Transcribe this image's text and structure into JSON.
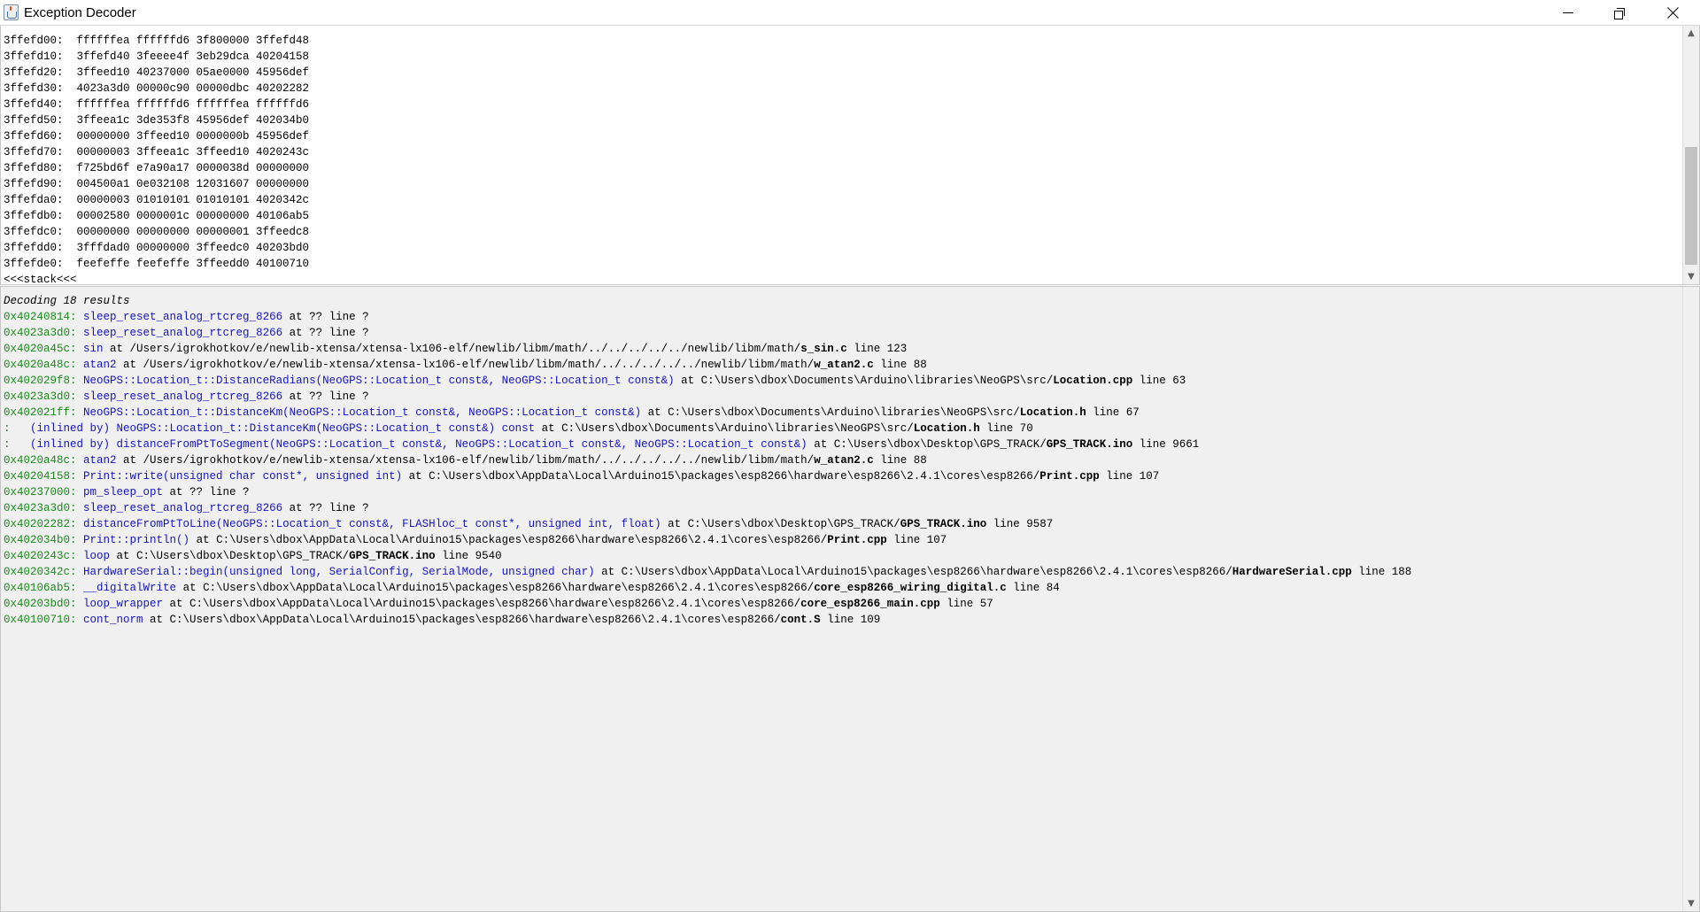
{
  "window": {
    "title": "Exception Decoder",
    "icons": {
      "app": "java-cup-icon",
      "minimize": "minimize-icon",
      "restore": "restore-icon",
      "close": "close-icon"
    }
  },
  "stack": {
    "rows": [
      "3ffefd00:  ffffffea ffffffd6 3f800000 3ffefd48",
      "3ffefd10:  3ffefd40 3feeee4f 3eb29dca 40204158",
      "3ffefd20:  3ffeed10 40237000 05ae0000 45956def",
      "3ffefd30:  4023a3d0 00000c90 00000dbc 40202282",
      "3ffefd40:  ffffffea ffffffd6 ffffffea ffffffd6",
      "3ffefd50:  3ffeea1c 3de353f8 45956def 402034b0",
      "3ffefd60:  00000000 3ffeed10 0000000b 45956def",
      "3ffefd70:  00000003 3ffeea1c 3ffeed10 4020243c",
      "3ffefd80:  f725bd6f e7a90a17 0000038d 00000000",
      "3ffefd90:  004500a1 0e032108 12031607 00000000",
      "3ffefda0:  00000003 01010101 01010101 4020342c",
      "3ffefdb0:  00002580 0000001c 00000000 40106ab5",
      "3ffefdc0:  00000000 00000000 00000001 3ffeedc8",
      "3ffefdd0:  3fffdad0 00000000 3ffeedc0 40203bd0",
      "3ffefde0:  feefeffe feefeffe 3ffeedd0 40100710"
    ],
    "end_marker": "<<<stack<<<",
    "scroll_up": "▲",
    "scroll_down": "▼"
  },
  "decode": {
    "header": "Decoding 18 results",
    "scroll_down": "▼",
    "results": [
      {
        "addr": "0x40240814:",
        "fn": "sleep_reset_analog_rtcreg_8266",
        "loc": "",
        "file": "",
        "tail": " at ?? line ?"
      },
      {
        "addr": "0x4023a3d0:",
        "fn": "sleep_reset_analog_rtcreg_8266",
        "loc": "",
        "file": "",
        "tail": " at ?? line ?"
      },
      {
        "addr": "0x4020a45c:",
        "fn": "sin",
        "loc": " at /Users/igrokhotkov/e/newlib-xtensa/xtensa-lx106-elf/newlib/libm/math/../../../../../newlib/libm/math/",
        "file": "s_sin.c",
        "tail": " line 123"
      },
      {
        "addr": "0x4020a48c:",
        "fn": "atan2",
        "loc": " at /Users/igrokhotkov/e/newlib-xtensa/xtensa-lx106-elf/newlib/libm/math/../../../../../newlib/libm/math/",
        "file": "w_atan2.c",
        "tail": " line 88"
      },
      {
        "addr": "0x402029f8:",
        "fn": "NeoGPS::Location_t::DistanceRadians(NeoGPS::Location_t const&, NeoGPS::Location_t const&)",
        "loc": " at C:\\Users\\dbox\\Documents\\Arduino\\libraries\\NeoGPS\\src/",
        "file": "Location.cpp",
        "tail": " line 63"
      },
      {
        "addr": "0x4023a3d0:",
        "fn": "sleep_reset_analog_rtcreg_8266",
        "loc": "",
        "file": "",
        "tail": " at ?? line ?"
      },
      {
        "addr": "0x402021ff:",
        "fn": "NeoGPS::Location_t::DistanceKm(NeoGPS::Location_t const&, NeoGPS::Location_t const&)",
        "loc": " at C:\\Users\\dbox\\Documents\\Arduino\\libraries\\NeoGPS\\src/",
        "file": "Location.h",
        "tail": " line 67"
      },
      {
        "addr": ":",
        "fn": "  (inlined by) NeoGPS::Location_t::DistanceKm(NeoGPS::Location_t const&) const",
        "loc": " at C:\\Users\\dbox\\Documents\\Arduino\\libraries\\NeoGPS\\src/",
        "file": "Location.h",
        "tail": " line 70"
      },
      {
        "addr": ":",
        "fn": "  (inlined by) distanceFromPtToSegment(NeoGPS::Location_t const&, NeoGPS::Location_t const&, NeoGPS::Location_t const&)",
        "loc": " at C:\\Users\\dbox\\Desktop\\GPS_TRACK/",
        "file": "GPS_TRACK.ino",
        "tail": " line 9661"
      },
      {
        "addr": "0x4020a48c:",
        "fn": "atan2",
        "loc": " at /Users/igrokhotkov/e/newlib-xtensa/xtensa-lx106-elf/newlib/libm/math/../../../../../newlib/libm/math/",
        "file": "w_atan2.c",
        "tail": " line 88"
      },
      {
        "addr": "0x40204158:",
        "fn": "Print::write(unsigned char const*, unsigned int)",
        "loc": " at C:\\Users\\dbox\\AppData\\Local\\Arduino15\\packages\\esp8266\\hardware\\esp8266\\2.4.1\\cores\\esp8266/",
        "file": "Print.cpp",
        "tail": " line 107"
      },
      {
        "addr": "0x40237000:",
        "fn": "pm_sleep_opt",
        "loc": "",
        "file": "",
        "tail": " at ?? line ?"
      },
      {
        "addr": "0x4023a3d0:",
        "fn": "sleep_reset_analog_rtcreg_8266",
        "loc": "",
        "file": "",
        "tail": " at ?? line ?"
      },
      {
        "addr": "0x40202282:",
        "fn": "distanceFromPtToLine(NeoGPS::Location_t const&, FLASHloc_t const*, unsigned int, float)",
        "loc": " at C:\\Users\\dbox\\Desktop\\GPS_TRACK/",
        "file": "GPS_TRACK.ino",
        "tail": " line 9587"
      },
      {
        "addr": "0x402034b0:",
        "fn": "Print::println()",
        "loc": " at C:\\Users\\dbox\\AppData\\Local\\Arduino15\\packages\\esp8266\\hardware\\esp8266\\2.4.1\\cores\\esp8266/",
        "file": "Print.cpp",
        "tail": " line 107"
      },
      {
        "addr": "0x4020243c:",
        "fn": "loop",
        "loc": " at C:\\Users\\dbox\\Desktop\\GPS_TRACK/",
        "file": "GPS_TRACK.ino",
        "tail": " line 9540"
      },
      {
        "addr": "0x4020342c:",
        "fn": "HardwareSerial::begin(unsigned long, SerialConfig, SerialMode, unsigned char)",
        "loc": " at C:\\Users\\dbox\\AppData\\Local\\Arduino15\\packages\\esp8266\\hardware\\esp8266\\2.4.1\\cores\\esp8266/",
        "file": "HardwareSerial.cpp",
        "tail": " line 188"
      },
      {
        "addr": "0x40106ab5:",
        "fn": "__digitalWrite",
        "loc": " at C:\\Users\\dbox\\AppData\\Local\\Arduino15\\packages\\esp8266\\hardware\\esp8266\\2.4.1\\cores\\esp8266/",
        "file": "core_esp8266_wiring_digital.c",
        "tail": " line 84"
      },
      {
        "addr": "0x40203bd0:",
        "fn": "loop_wrapper",
        "loc": " at C:\\Users\\dbox\\AppData\\Local\\Arduino15\\packages\\esp8266\\hardware\\esp8266\\2.4.1\\cores\\esp8266/",
        "file": "core_esp8266_main.cpp",
        "tail": " line 57"
      },
      {
        "addr": "0x40100710:",
        "fn": "cont_norm",
        "loc": " at C:\\Users\\dbox\\AppData\\Local\\Arduino15\\packages\\esp8266\\hardware\\esp8266\\2.4.1\\cores\\esp8266/",
        "file": "cont.S",
        "tail": " line 109"
      }
    ]
  }
}
